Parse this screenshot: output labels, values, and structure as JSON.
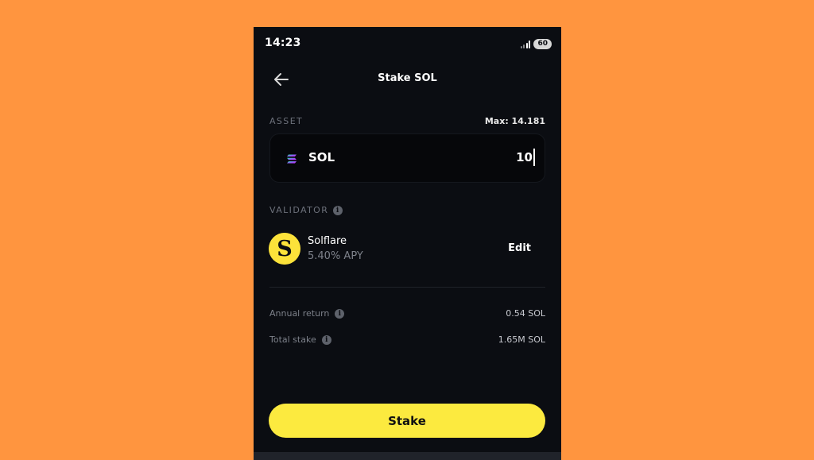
{
  "status_bar": {
    "time": "14:23",
    "battery": "60"
  },
  "header": {
    "title": "Stake SOL"
  },
  "asset": {
    "section_label": "ASSET",
    "max_label": "Max: 14.181",
    "name": "SOL",
    "amount": "10"
  },
  "validator": {
    "section_label": "VALIDATOR",
    "name": "Solflare",
    "apy": "5.40% APY",
    "edit_label": "Edit",
    "logo_letter": "S"
  },
  "summary": {
    "rows": [
      {
        "label": "Annual return",
        "value": "0.54 SOL"
      },
      {
        "label": "Total stake",
        "value": "1.65M SOL"
      }
    ]
  },
  "actions": {
    "stake_label": "Stake"
  },
  "colors": {
    "background": "#FF953F",
    "panel": "#0B0D12",
    "accent": "#FCEA3F",
    "muted_text": "#7D818A"
  }
}
